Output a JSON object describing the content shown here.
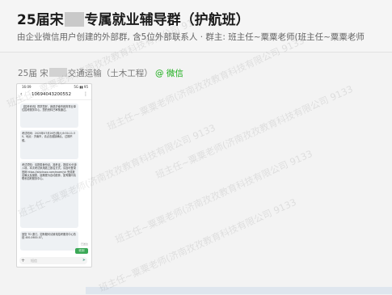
{
  "header": {
    "title_prefix": "25届宋",
    "title_suffix": "专属就业辅导群（护航班）",
    "subtitle": "由企业微信用户创建的外部群, 含5位外部联系人 · 群主: 班主任~粟粟老师(班主任~粟粟老师"
  },
  "message": {
    "sender_prefix": "25届 宋",
    "sender_suffix": "交通运输（土木工程）",
    "sender_tag": "@ 微信"
  },
  "phone": {
    "status_time": "16:09",
    "status_signal": "5G ▮▮ 95",
    "sms_number": "10694043200552",
    "bubble1": "【招考资讯】同学您好，我是济南市政府事业单位招考服务中心，您的资料已审核通过。",
    "bubble2": "考试时间：2025年07月26日(周六)9:30-11:30，地点：济南市，请点击链接确认，过期不候。",
    "bubble3": "考试须知：请携带身份证、准考证，提前30分钟入场。本次考试采用线上报名方式，请及时登录官网 https://shjcksxx.com/exam/yk 完成报名确认及缴费，逾期视为自动放弃，如有疑问请联系招考服务中心。",
    "bubble4": "回复 TD 退订，如有疑问请致电招考服务中心热线 400-0600-07。",
    "reply_label": "收到",
    "reply_time": "已送达",
    "input_placeholder": "短信"
  },
  "watermarks": [
    "班主任~粟粟老师(济南孜孜教育科技有限公司 9133",
    "班主任~粟粟老师(济南孜孜教育科技有限公司 9133",
    "班主任~粟粟老师(济南孜孜教育科技有限公司 9133",
    "班主任~粟粟老师(济南孜孜教育科技有限公司 9133",
    "班主任~粟粟老师(济南孜孜教育科技有限公司 9133",
    "班主任~粟粟老师(济南孜孜教育科技有限公司 9133"
  ],
  "colors": {
    "accent": "#1aad19",
    "link": "#2f7cd6",
    "reply": "#3aa856"
  }
}
